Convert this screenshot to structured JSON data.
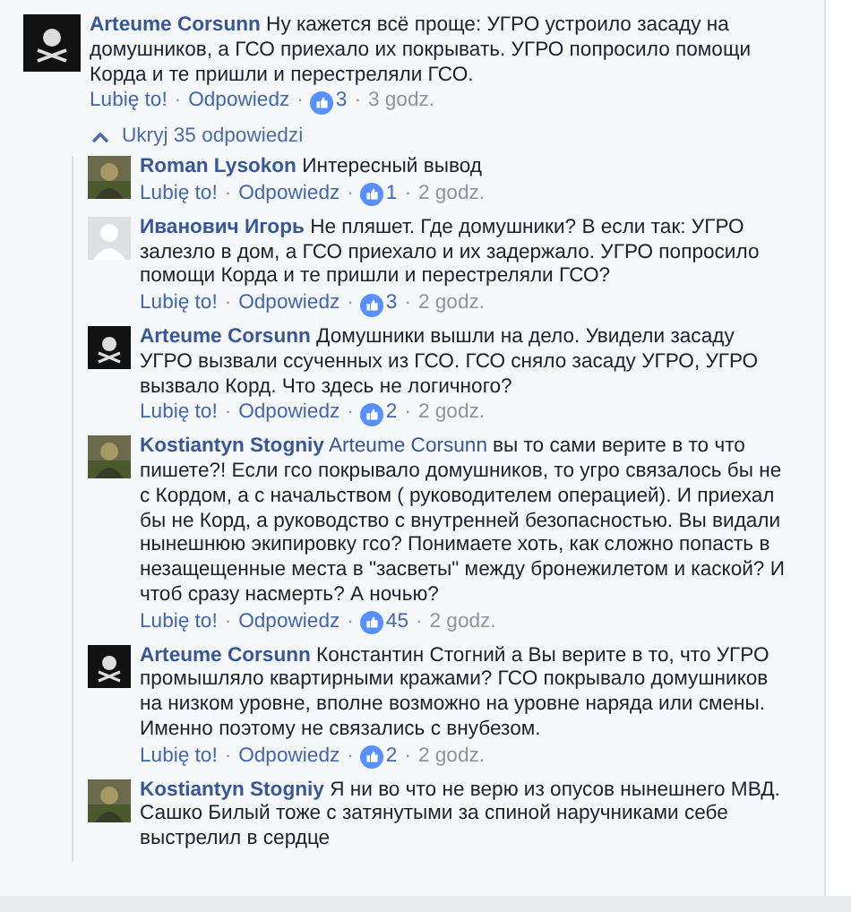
{
  "separator": "·",
  "comment": {
    "author": "Arteume Corsunn",
    "avatar": {
      "kind": "logo"
    },
    "text": "Ну кажется всё проще: УГРО устроило засаду на домушников, а ГСО приехало их покрывать. УГРО попросило помощи Корда и те пришли и перестреляли ГСО.",
    "like": "Lubię to!",
    "reply": "Odpowiedz",
    "reactions": "3",
    "time": "3 godz."
  },
  "toggle": {
    "label": "Ukryj 35 odpowiedzi"
  },
  "replies": [
    {
      "author": "Roman Lysokon",
      "avatar": {
        "kind": "photo"
      },
      "text": "Интересный вывод",
      "like": "Lubię to!",
      "reply": "Odpowiedz",
      "reactions": "1",
      "time": "2 godz."
    },
    {
      "author": "Иванович Игорь",
      "avatar": {
        "kind": "default"
      },
      "text": "Не пляшет. Где домушники? В если так: УГРО залезло в дом, а ГСО приехало и их задержало. УГРО попросило помощи Корда и те пришли и перестреляли ГСО?",
      "like": "Lubię to!",
      "reply": "Odpowiedz",
      "reactions": "3",
      "time": "2 godz."
    },
    {
      "author": "Arteume Corsunn",
      "avatar": {
        "kind": "logo"
      },
      "text": "Домушники вышли на дело. Увидели засаду УГРО вызвали ссученных из ГСО. ГСО сняло засаду УГРО, УГРО вызвало Корд. Что здесь не логичного?",
      "like": "Lubię to!",
      "reply": "Odpowiedz",
      "reactions": "2",
      "time": "2 godz."
    },
    {
      "author": "Kostiantyn Stogniy",
      "avatar": {
        "kind": "photo"
      },
      "mention": "Arteume Corsunn",
      "text": "вы то сами верите в то что пишете?! Если гсо покрывало домушников, то угро связалось бы не с Кордом, а с начальством ( руководителем операцией). И приехал бы не Корд, а руководство с внутренней безопасностью. Вы видали нынешнюю экипировку гсо? Понимаете хоть, как сложно попасть в незащещенные места в \"засветы\" между бронежилетом и каской? И чтоб сразу насмерть? А ночью?",
      "like": "Lubię to!",
      "reply": "Odpowiedz",
      "reactions": "45",
      "time": "2 godz."
    },
    {
      "author": "Arteume Corsunn",
      "avatar": {
        "kind": "logo"
      },
      "text": "Константин Стогний а Вы верите в то, что УГРО промышляло квартирными кражами? ГСО покрывало домушников на низком уровне, вполне возможно на уровне наряда или смены. Именно поэтому не связались с внубезом.",
      "like": "Lubię to!",
      "reply": "Odpowiedz",
      "reactions": "2",
      "time": "2 godz."
    },
    {
      "author": "Kostiantyn Stogniy",
      "avatar": {
        "kind": "photo"
      },
      "text": "Я ни во что не верю из опусов нынешнего МВД. Сашко Билый тоже с затянутыми за спиной наручниками себе выстрелил в сердце"
    }
  ]
}
